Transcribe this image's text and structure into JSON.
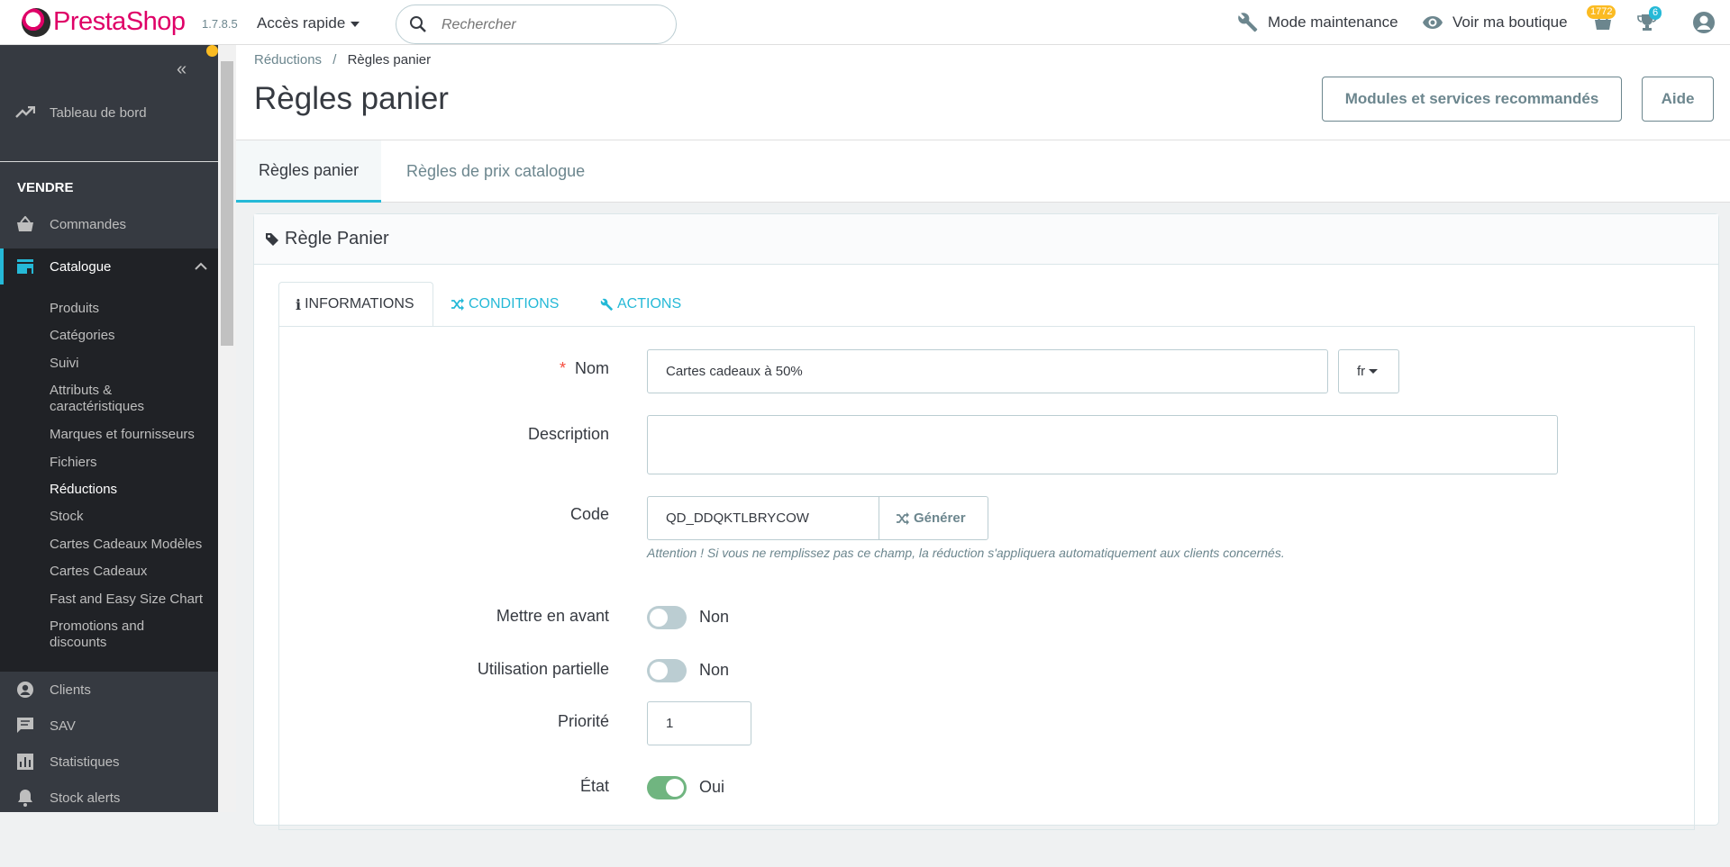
{
  "header": {
    "logo": "PrestaShop",
    "version": "1.7.8.5",
    "quick_access": "Accès rapide",
    "search_placeholder": "Rechercher",
    "maintenance": "Mode maintenance",
    "view_shop": "Voir ma boutique",
    "orders_badge": "1772",
    "customers_badge": "6"
  },
  "sidebar": {
    "dashboard": "Tableau de bord",
    "section_sell": "VENDRE",
    "orders": "Commandes",
    "catalogue": "Catalogue",
    "catalogue_items": [
      "Produits",
      "Catégories",
      "Suivi",
      "Attributs & caractéristiques",
      "Marques et fournisseurs",
      "Fichiers",
      "Réductions",
      "Stock",
      "Cartes Cadeaux Modèles",
      "Cartes Cadeaux",
      "Fast and Easy Size Chart",
      "Promotions and discounts"
    ],
    "clients": "Clients",
    "sav": "SAV",
    "stats": "Statistiques",
    "stock_alerts": "Stock alerts"
  },
  "page": {
    "breadcrumb_parent": "Réductions",
    "breadcrumb_sep": "/",
    "breadcrumb_current": "Règles panier",
    "title": "Règles panier",
    "btn_modules": "Modules et services recommandés",
    "btn_help": "Aide",
    "tab_cart_rules": "Règles panier",
    "tab_catalog_rules": "Règles de prix catalogue"
  },
  "panel": {
    "title": "Règle Panier",
    "tab_info": "INFORMATIONS",
    "tab_conditions": "CONDITIONS",
    "tab_actions": "ACTIONS",
    "required_mark": "*",
    "name_label": "Nom",
    "name_value": "Cartes cadeaux à 50%",
    "lang": "fr",
    "description_label": "Description",
    "description_value": "",
    "code_label": "Code",
    "code_value": "QD_DDQKTLBRYCOW",
    "generate": "Générer",
    "code_hint": "Attention ! Si vous ne remplissez pas ce champ, la réduction s'appliquera automatiquement aux clients concernés.",
    "highlight_label": "Mettre en avant",
    "highlight_value": "Non",
    "partial_label": "Utilisation partielle",
    "partial_value": "Non",
    "priority_label": "Priorité",
    "priority_value": "1",
    "status_label": "État",
    "status_value": "Oui"
  },
  "colors": {
    "accent": "#25b9d7",
    "brand": "#df0067",
    "sidebar": "#363a41",
    "switch_on": "#70b580",
    "badge_orange": "#fbbb22"
  }
}
